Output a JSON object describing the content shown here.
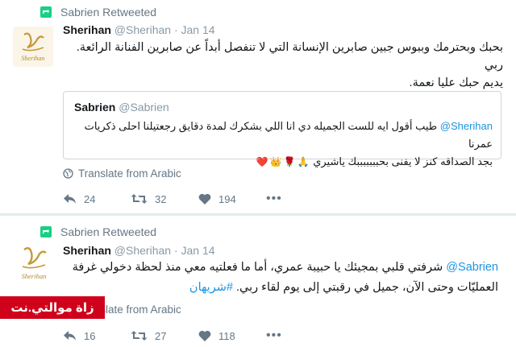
{
  "tweets": [
    {
      "retweet_label": "Sabrien Retweeted",
      "author_name": "Sherihan",
      "author_handle": "@Sherihan",
      "date": "· Jan 14",
      "avatar_text": "Sherihan",
      "text_line1": "بحبك وبحترمك وببوس جبين صابرين الإنسانة التي لا تنفصل أبداً عن صابرين الفنانة الرائعة. ربي",
      "text_line2": "يديم حبك عليا نعمة.",
      "quote": {
        "author_name": "Sabrien",
        "author_handle": "@Sabrien",
        "mention": "@Sherihan",
        "text_line1": "طيب أقول ايه للست الجميله دي انا اللي بشكرك لمدة دقايق رجعتيلنا احلى ذكريات عمرنا",
        "text_line2": "بجد الصداقه كنز لا يفنى بحبببببببك ياشيري",
        "emojis": [
          "🙏",
          "🌹",
          "👑",
          "❤️"
        ]
      },
      "translate_label": "Translate from Arabic",
      "reply_count": "24",
      "retweet_count": "32",
      "like_count": "194",
      "more_label": "•••"
    },
    {
      "retweet_label": "Sabrien Retweeted",
      "author_name": "Sherihan",
      "author_handle": "@Sherihan",
      "date": "· Jan 14",
      "avatar_text": "Sherihan",
      "mention": "@Sabrien",
      "text_line1": "شرفتي قلبي بمجيئك يا حبيبة عمري، أما ما فعلتيه معي منذ لحظة دخولي غرفة",
      "text_line2": "العمليّات وحتى الآن، جميل في رقبتي إلى يوم لقاء ربي.",
      "hashtag": "#شريهان",
      "translate_label": "Translate from Arabic",
      "reply_count": "16",
      "retweet_count": "27",
      "like_count": "118",
      "more_label": "•••"
    }
  ],
  "watermark": "زاة موالتي.نت",
  "colors": {
    "retweet_green": "#19cf86",
    "link_blue": "#1b95e0",
    "muted": "#657786",
    "watermark_red": "#d0021b"
  }
}
